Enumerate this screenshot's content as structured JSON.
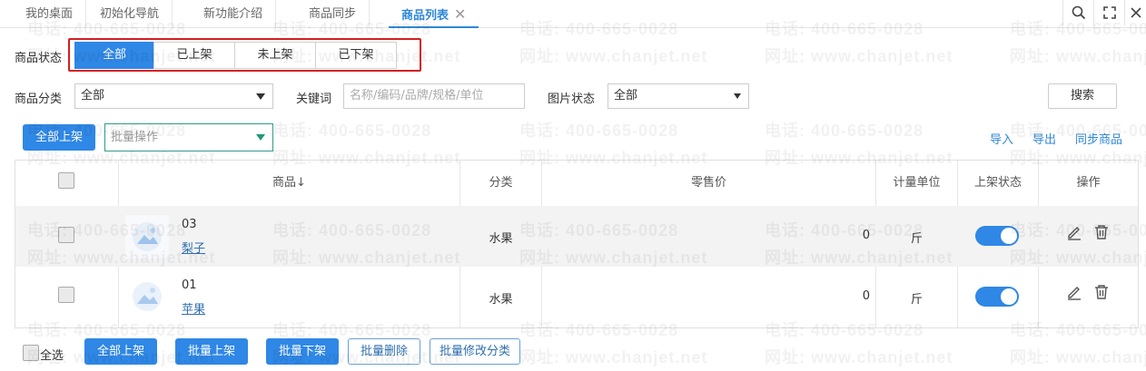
{
  "tabs": [
    {
      "label": "我的桌面"
    },
    {
      "label": "初始化导航"
    },
    {
      "label": "新功能介绍"
    },
    {
      "label": "商品同步"
    },
    {
      "label": "商品列表",
      "active": true
    }
  ],
  "tab_close": "✕",
  "toolbar_icons": [
    "search-icon",
    "fullscreen-icon",
    "close-icon"
  ],
  "filters": {
    "status_label": "商品状态",
    "status_options": [
      "全部",
      "已上架",
      "未上架",
      "已下架"
    ],
    "status_selected": "全部",
    "category_label": "商品分类",
    "category_value": "全部",
    "keyword_label": "关键词",
    "keyword_placeholder": "名称/编码/品牌/规格/单位",
    "image_status_label": "图片状态",
    "image_status_value": "全部",
    "search_button": "搜索"
  },
  "actions": {
    "all_on_shelf": "全部上架",
    "batch_ops_placeholder": "批量操作",
    "import": "导入",
    "export": "导出",
    "sync": "同步商品"
  },
  "table": {
    "headers": [
      "商品↓",
      "分类",
      "零售价",
      "计量单位",
      "上架状态",
      "操作"
    ],
    "rows": [
      {
        "code": "03",
        "name": "梨子",
        "category": "水果",
        "price": "0",
        "unit": "斤",
        "on_shelf": true
      },
      {
        "code": "01",
        "name": "苹果",
        "category": "水果",
        "price": "0",
        "unit": "斤",
        "on_shelf": true
      }
    ]
  },
  "footer": {
    "select_all": "全选",
    "all_on_shelf": "全部上架",
    "batch_on_shelf": "批量上架",
    "batch_off_shelf": "批量下架",
    "batch_delete": "批量删除",
    "batch_change_category": "批量修改分类"
  },
  "watermark": {
    "phone": "电话: 400-665-0028",
    "site": "网址: www.chanjet.net"
  },
  "colors": {
    "accent": "#2f87e6",
    "highlight": "#d42020"
  }
}
